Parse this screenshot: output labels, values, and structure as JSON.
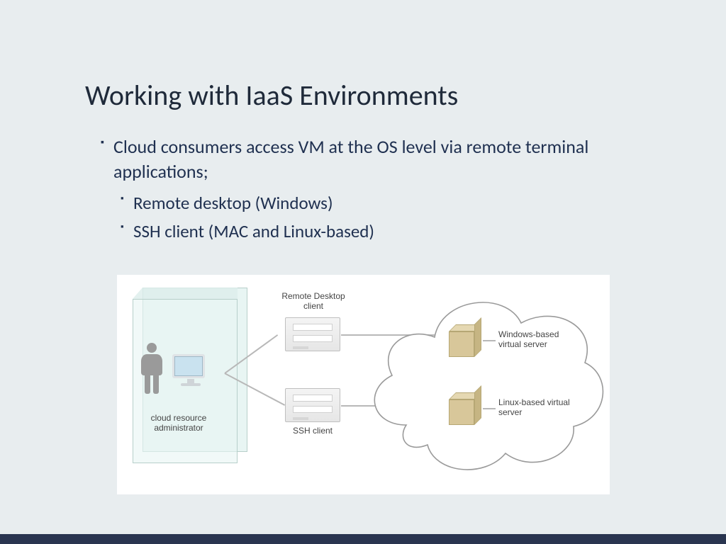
{
  "title": "Working with IaaS Environments",
  "bullets": {
    "main": "Cloud consumers access VM at the OS level via remote terminal applications;",
    "sub1": "Remote desktop (Windows)",
    "sub2": "SSH client (MAC and Linux-based)"
  },
  "diagram": {
    "admin_label": "cloud resource administrator",
    "remote_desktop_label": "Remote Desktop client",
    "ssh_label": "SSH client",
    "windows_vs_label": "Windows-based virtual server",
    "linux_vs_label": "Linux-based virtual server"
  }
}
